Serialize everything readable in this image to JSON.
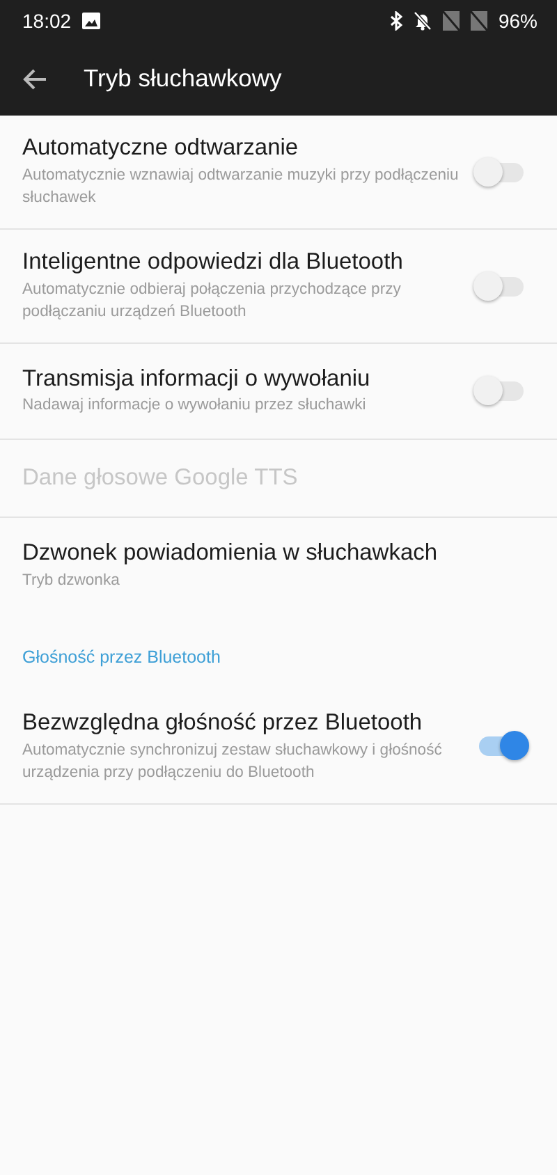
{
  "status_bar": {
    "time": "18:02",
    "battery": "96%"
  },
  "app_bar": {
    "title": "Tryb słuchawkowy"
  },
  "items": [
    {
      "kind": "switch",
      "title": "Automatyczne odtwarzanie",
      "subtitle": "Automatycznie wznawiaj odtwarzanie muzyki przy podłączeniu słuchawek",
      "on": false,
      "disabled": false
    },
    {
      "kind": "switch",
      "title": "Inteligentne odpowiedzi dla Bluetooth",
      "subtitle": "Automatycznie odbieraj połączenia przychodzące przy podłączaniu urządzeń Bluetooth",
      "on": false,
      "disabled": false
    },
    {
      "kind": "switch",
      "title": "Transmisja informacji o wywołaniu",
      "subtitle": "Nadawaj informacje o wywołaniu przez słuchawki",
      "on": false,
      "disabled": false
    },
    {
      "kind": "plain",
      "title": "Dane głosowe Google TTS",
      "disabled": true
    },
    {
      "kind": "plain",
      "title": "Dzwonek powiadomienia w słuchawkach",
      "subtitle": "Tryb dzwonka",
      "disabled": false
    },
    {
      "kind": "header",
      "title": "Głośność przez Bluetooth"
    },
    {
      "kind": "switch",
      "title": "Bezwzględna głośność przez Bluetooth",
      "subtitle": "Automatycznie synchronizuj zestaw słuchawkowy i głośność urządzenia przy podłączeniu do Bluetooth",
      "on": true,
      "disabled": false
    }
  ]
}
